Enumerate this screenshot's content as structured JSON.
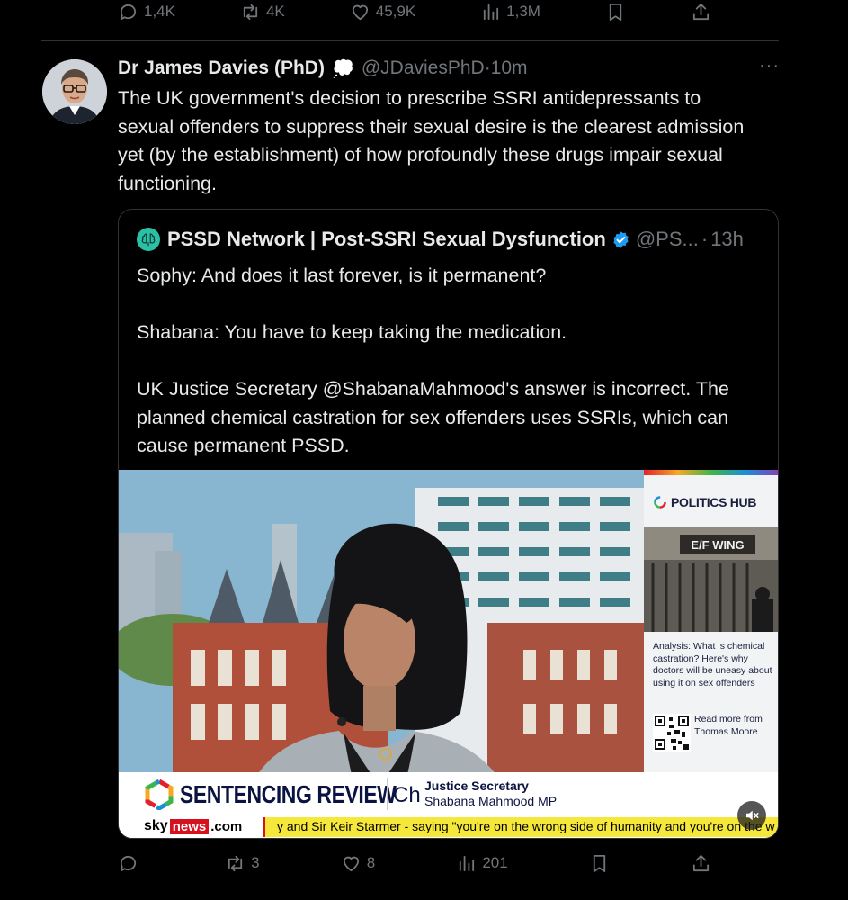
{
  "prev_tweet_actions": {
    "replies": "1,4K",
    "retweets": "4K",
    "likes": "45,9K",
    "views": "1,3M"
  },
  "tweet": {
    "author_name": "Dr James Davies (PhD)",
    "author_badge": "💭",
    "handle": "@JDaviesPhD",
    "separator": "·",
    "time": "10m",
    "more": "···",
    "text": "The UK government's decision to prescribe SSRI antidepressants to sexual offenders to suppress their sexual desire is the clearest admission yet (by the establishment) of how profoundly these drugs impair sexual functioning."
  },
  "quote": {
    "author_name": "PSSD Network | Post-SSRI Sexual Dysfunction",
    "handle": "@PS...",
    "separator": "·",
    "time": "13h",
    "paragraphs": [
      "Sophy: And does it last forever, is it permanent?",
      "Shabana: You have to keep taking the medication.",
      "UK Justice Secretary @ShabanaMahmood's answer is incorrect. The planned chemical castration for sex offenders uses SSRIs, which can cause permanent PSSD."
    ]
  },
  "media": {
    "side_brand": "POLITICS HUB",
    "sign_text": "E/F WING",
    "analysis": "Analysis: What is chemical castration? Here's why doctors will be uneasy about using it on sex offenders",
    "read_more": "Read more from Thomas Moore",
    "lower_third_title": "SENTENCING REVIEW",
    "lower_third_cut": "Ch",
    "person_role": "Justice Secretary",
    "person_name": "Shabana Mahmood MP",
    "sky": "sky",
    "news": "news",
    "dotcom": ".com",
    "ticker": "y and Sir Keir Starmer - saying \"you're on the wrong side of humanity and you're on the w"
  },
  "tweet_actions": {
    "replies": "",
    "retweets": "3",
    "likes": "8",
    "views": "201"
  },
  "colors": {
    "background": "#000000",
    "text": "#e7e9ea",
    "muted": "#71767b",
    "border": "#2f3336",
    "verified": "#1d9bf0"
  }
}
